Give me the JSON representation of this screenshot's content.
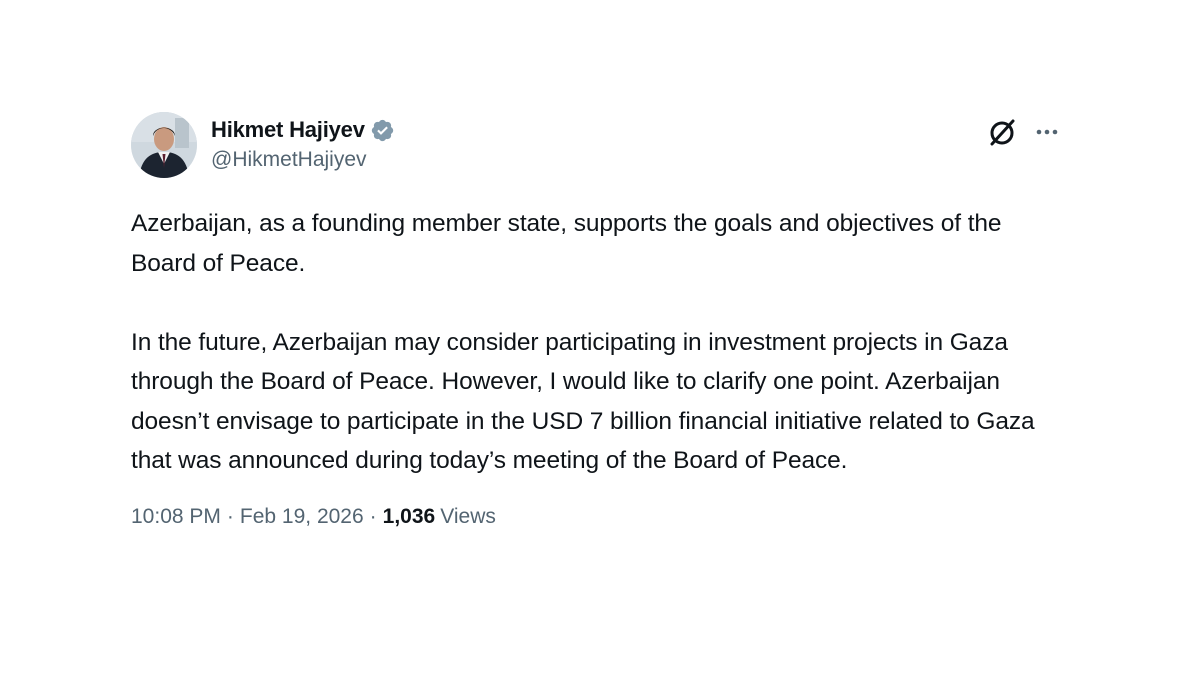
{
  "author": {
    "display_name": "Hikmet Hajiyev",
    "handle": "@HikmetHajiyev",
    "verified": true,
    "verified_color": "#829aab",
    "avatar_icon": "profile-photo"
  },
  "actions": {
    "grok_icon": "grok-slashed-circle-icon",
    "more_icon": "more-dots-icon"
  },
  "tweet": {
    "paragraphs": [
      "Azerbaijan, as a founding member state, supports the goals and objectives of the Board of Peace.",
      "In the future, Azerbaijan may consider participating in investment projects in Gaza through the Board of Peace. However, I would like to clarify one point. Azerbaijan doesn’t envisage to participate in the USD 7 billion financial initiative related to Gaza that was announced during today’s meeting of the Board of Peace."
    ]
  },
  "meta": {
    "time": "10:08 PM",
    "separator": "·",
    "date": "Feb 19, 2026",
    "views_count": "1,036",
    "views_label": "Views"
  },
  "colors": {
    "text_primary": "#0f1419",
    "text_secondary": "#536471",
    "background": "#ffffff"
  }
}
